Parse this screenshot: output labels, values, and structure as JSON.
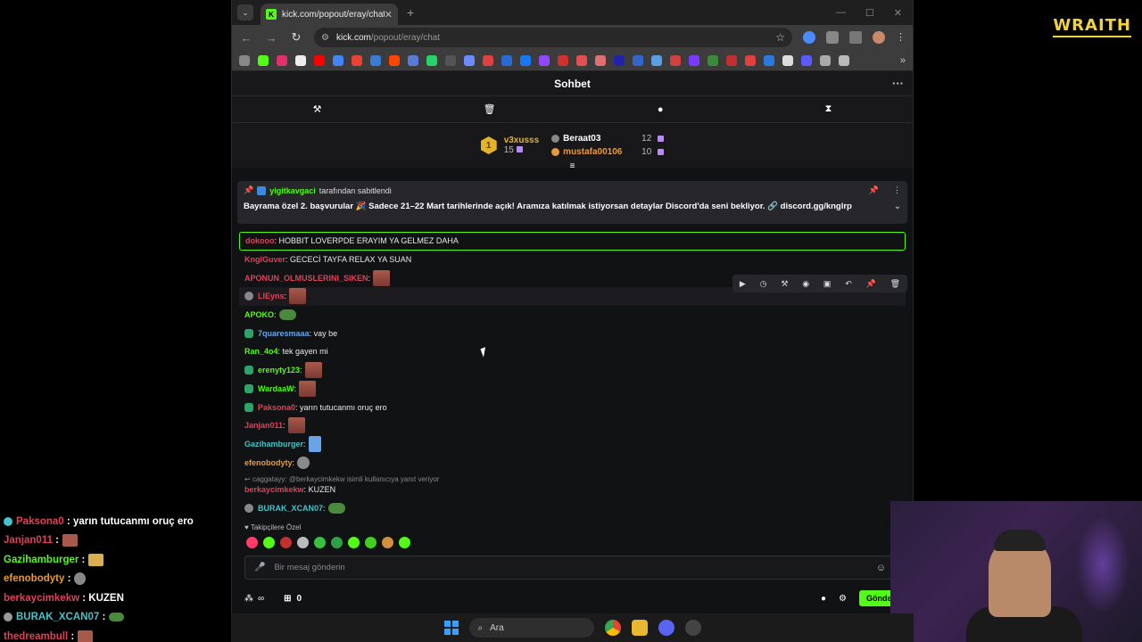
{
  "colors": {
    "kick_green": "#53fc18",
    "gold": "#e3b32b",
    "gift_purple": "#b98aff",
    "bg": "#111214"
  },
  "browser": {
    "tab_title": "kick.com/popout/eray/chat",
    "url_host": "kick.com",
    "url_path": "/popout/eray/chat"
  },
  "chat": {
    "title": "Sohbet",
    "mod_tools": [
      "hammer-icon",
      "trash-icon",
      "chat-bubble-icon",
      "hourglass-icon"
    ],
    "leaderboard": {
      "rank": "1",
      "top_name": "v3xusss",
      "top_count": "15",
      "rows": [
        {
          "name": "Beraat03",
          "count": "12"
        },
        {
          "name": "mustafa00106",
          "count": "10"
        }
      ]
    },
    "pinned": {
      "pinned_by_user": "yigitkavgaci",
      "pinned_by_suffix": "tarafından sabitlendi",
      "text": "Bayrama özel 2. başvurular 🎉 Sadece 21–22 Mart tarihlerinde açık! Aramıza katılmak istiyorsan detaylar Discord'da seni bekliyor. 🔗 discord.gg/knglrp"
    },
    "messages": [
      {
        "user": "dokooo",
        "color": "#e0405a",
        "text": "HOBBIT LOVERPDE ERAYIM YA GELMEZ DAHA",
        "emote": "",
        "badge": "",
        "highlight": true
      },
      {
        "user": "KnglGuver",
        "color": "#e0405a",
        "text": "GECECİ TAYFA RELAX YA SUAN",
        "emote": "",
        "badge": ""
      },
      {
        "user": "APONUN_OLMUSLERINI_SIKEN",
        "color": "#e0405a",
        "text": "",
        "emote": "face",
        "badge": ""
      },
      {
        "user": "LIEyns",
        "color": "#e0405a",
        "text": "",
        "emote": "face",
        "badge": "gray",
        "hover": true
      },
      {
        "user": "APOKO",
        "color": "#53fc18",
        "text": "",
        "emote": "frog",
        "badge": ""
      },
      {
        "user": "7quaresmaaa",
        "color": "#6aa4e8",
        "text": "vay be",
        "emote": "",
        "badge": "green"
      },
      {
        "user": "Ran_4o4",
        "color": "#53fc18",
        "text": "tek gayen mi",
        "emote": "",
        "badge": ""
      },
      {
        "user": "erenyty123",
        "color": "#53fc18",
        "text": "",
        "emote": "face",
        "badge": "green"
      },
      {
        "user": "WardaaW",
        "color": "#53fc18",
        "text": "",
        "emote": "face",
        "badge": "green"
      },
      {
        "user": "Paksona0",
        "color": "#e0405a",
        "text": "yarın tutucanmı oruç ero",
        "emote": "",
        "badge": "green"
      },
      {
        "user": "Janjan011",
        "color": "#e0405a",
        "text": "",
        "emote": "face",
        "badge": ""
      },
      {
        "user": "Gazihamburger",
        "color": "#46c2c8",
        "text": "",
        "emote": "wing",
        "badge": ""
      },
      {
        "user": "efenobodyty",
        "color": "#e89a3a",
        "text": "",
        "emote": "ghost",
        "badge": ""
      }
    ],
    "reply": {
      "reply_line": "caggatayy: @berkaycimkekw isimli kullanıcıya yanıt veriyor",
      "user": "berkaycimkekw",
      "text": "KUZEN"
    },
    "last_message": {
      "user": "BURAK_XCAN07",
      "text": ""
    },
    "followers_only": "Takipçilere Özel",
    "composer_placeholder": "Bir mesaj gönderin",
    "points": "∞",
    "boxes": "0",
    "send_label": "Gönder"
  },
  "overlay": [
    {
      "user": "Paksona0",
      "color": "#e0405a",
      "text": "yarın tutucanmı oruç ero",
      "badge": true
    },
    {
      "user": "Janjan011",
      "color": "#e0405a",
      "text": "",
      "emote": "face"
    },
    {
      "user": "Gazihamburger",
      "color": "#53fc18",
      "text": "",
      "emote": "wing"
    },
    {
      "user": "efenobodyty",
      "color": "#e89a3a",
      "text": "",
      "emote": "ghost"
    },
    {
      "user": "berkaycimkekw",
      "color": "#e0405a",
      "text": "KUZEN"
    },
    {
      "user": "BURAK_XCAN07",
      "color": "#46c2c8",
      "text": "",
      "emote": "frog",
      "badge": true
    },
    {
      "user": "thedreambull",
      "color": "#e0405a",
      "text": "",
      "emote": "face"
    }
  ],
  "logo": "WRAITH",
  "taskbar": {
    "search_label": "Ara"
  }
}
